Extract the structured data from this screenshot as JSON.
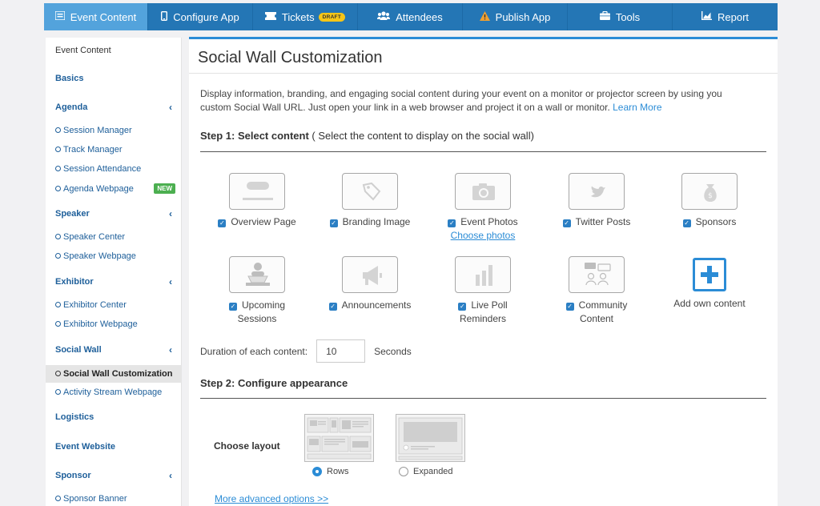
{
  "nav": {
    "tabs": [
      {
        "label": "Event Content",
        "icon": "content-icon"
      },
      {
        "label": "Configure App",
        "icon": "phone-icon"
      },
      {
        "label": "Tickets",
        "icon": "ticket-icon",
        "badge": "DRAFT"
      },
      {
        "label": "Attendees",
        "icon": "users-icon"
      },
      {
        "label": "Publish App",
        "icon": "warning-icon"
      },
      {
        "label": "Tools",
        "icon": "briefcase-icon"
      },
      {
        "label": "Report",
        "icon": "chart-icon"
      }
    ],
    "active_color": "#53a3dc",
    "bar_color": "#2476b5"
  },
  "sidebar": {
    "title": "Event Content",
    "sections": {
      "basics": "Basics",
      "agenda": "Agenda",
      "speaker": "Speaker",
      "exhibitor": "Exhibitor",
      "social_wall": "Social Wall",
      "logistics": "Logistics",
      "event_website": "Event Website",
      "sponsor": "Sponsor"
    },
    "items": {
      "session_manager": "Session Manager",
      "track_manager": "Track Manager",
      "session_attendance": "Session Attendance",
      "agenda_webpage": "Agenda Webpage",
      "new_badge": "NEW",
      "speaker_center": "Speaker Center",
      "speaker_webpage": "Speaker Webpage",
      "exhibitor_center": "Exhibitor Center",
      "exhibitor_webpage": "Exhibitor Webpage",
      "social_wall_customization": "Social Wall Customization",
      "activity_stream_webpage": "Activity Stream Webpage",
      "sponsor_banner": "Sponsor Banner"
    }
  },
  "main": {
    "title": "Social Wall Customization",
    "description": "Display information, branding, and engaging social content during your event on a monitor or projector screen by using you custom Social Wall URL. Just open your link in a web browser and project it on a wall or monitor.",
    "learn_more": "Learn More",
    "step1_bold": "Step 1: Select content",
    "step1_rest": " ( Select the content to display on the social wall)",
    "content_items": {
      "overview": "Overview Page",
      "branding": "Branding Image",
      "photos": "Event Photos",
      "choose_photos": "Choose photos",
      "twitter": "Twitter Posts",
      "sponsors": "Sponsors",
      "upcoming_1": "Upcoming",
      "upcoming_2": "Sessions",
      "announcements": "Announcements",
      "poll_1": "Live Poll",
      "poll_2": "Reminders",
      "community_1": "Community",
      "community_2": "Content",
      "add_own": "Add own content"
    },
    "duration_label": "Duration of each content:",
    "duration_value": "10",
    "duration_unit": "Seconds",
    "step2": "Step 2: Configure appearance",
    "choose_layout": "Choose layout",
    "layout_rows": "Rows",
    "layout_expanded": "Expanded",
    "selected_layout": "Rows",
    "advanced": "More advanced options >>"
  }
}
